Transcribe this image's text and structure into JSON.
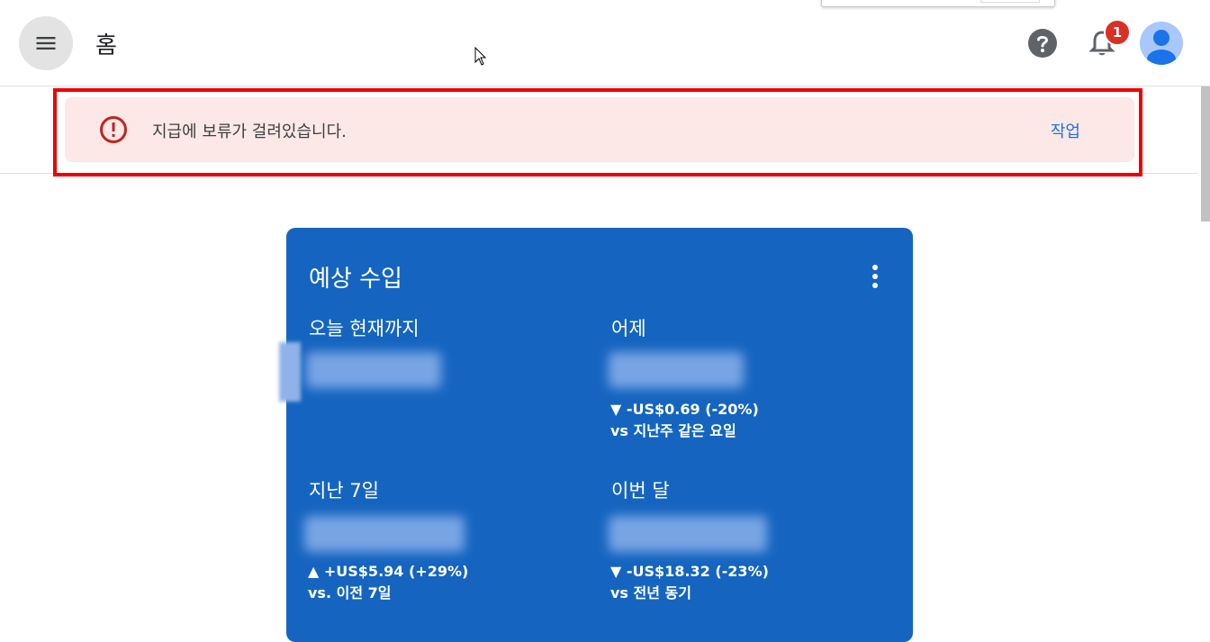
{
  "header": {
    "title": "홈",
    "notification_count": "1"
  },
  "alert": {
    "message": "지급에 보류가 걸려있습니다.",
    "action_label": "작업"
  },
  "card": {
    "title": "예상 수입",
    "metrics": [
      {
        "label": "오늘 현재까지",
        "delta": "",
        "comparison": ""
      },
      {
        "label": "어제",
        "delta": "▼ -US$0.69 (-20%)",
        "comparison": "vs 지난주 같은 요일"
      },
      {
        "label": "지난 7일",
        "delta": "▲ +US$5.94 (+29%)",
        "comparison": "vs. 이전 7일"
      },
      {
        "label": "이번 달",
        "delta": "▼ -US$18.32 (-23%)",
        "comparison": "vs 전년 동기"
      }
    ]
  },
  "colors": {
    "card_bg": "#1565c0",
    "alert_bg": "#fce8e6",
    "alert_icon": "#c5221f",
    "action_link": "#1a73e8",
    "badge": "#d93025",
    "highlight": "#ee0000"
  },
  "icons": {
    "menu": "menu-icon",
    "help": "help-icon",
    "bell": "bell-icon",
    "avatar": "avatar-icon",
    "alert": "error-icon",
    "more": "more-vert-icon"
  }
}
